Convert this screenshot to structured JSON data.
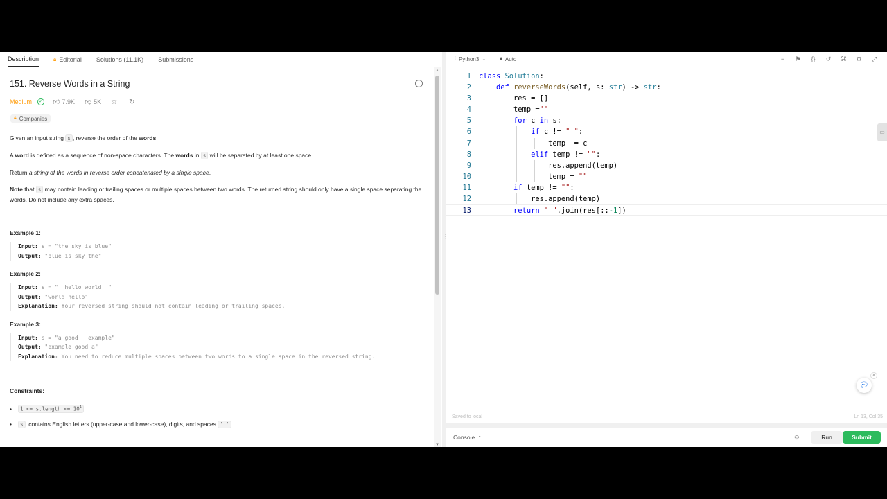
{
  "tabs": [
    {
      "label": "Description"
    },
    {
      "label": "Editorial"
    },
    {
      "label": "Solutions (11.1K)"
    },
    {
      "label": "Submissions"
    }
  ],
  "problem": {
    "title": "151. Reverse Words in a String",
    "difficulty": "Medium",
    "likes": "7.9K",
    "dislikes": "5K",
    "companies_label": "Companies",
    "desc1_a": "Given an input string ",
    "desc1_code": "s",
    "desc1_b": ", reverse the order of the ",
    "desc1_bold": "words",
    "desc1_c": ".",
    "desc2_a": "A ",
    "desc2_bold1": "word",
    "desc2_b": " is defined as a sequence of non-space characters. The ",
    "desc2_bold2": "words",
    "desc2_c": " in ",
    "desc2_code": "s",
    "desc2_d": " will be separated by at least one space.",
    "desc3_a": "Return ",
    "desc3_em": "a string of the words in reverse order concatenated by a single space",
    "desc3_b": ".",
    "note_bold": "Note",
    "note_a": " that ",
    "note_code": "s",
    "note_b": " may contain leading or trailing spaces or multiple spaces between two words. The returned string should only have a single space separating the words. Do not include any extra spaces."
  },
  "examples": [
    {
      "title": "Example 1:",
      "input": "s = \"the sky is blue\"",
      "output": "\"blue is sky the\""
    },
    {
      "title": "Example 2:",
      "input": "s = \"  hello world  \"",
      "output": "\"world hello\"",
      "explanation": "Your reversed string should not contain leading or trailing spaces."
    },
    {
      "title": "Example 3:",
      "input": "s = \"a good   example\"",
      "output": "\"example good a\"",
      "explanation": "You need to reduce multiple spaces between two words to a single space in the reversed string."
    }
  ],
  "labels": {
    "input": "Input:",
    "output": "Output:",
    "explanation": "Explanation:"
  },
  "constraints": {
    "title": "Constraints:",
    "c1_code": "1 <= s.length <= 10",
    "c1_sup": "4",
    "c2_code": "s",
    "c2_text": " contains English letters (upper-case and lower-case), digits, and spaces ",
    "c2_code2": "' '",
    "c2_end": "."
  },
  "editor": {
    "language": "Python3",
    "mode": "Auto",
    "saved": "Saved to local",
    "cursor": "Ln 13, Col 35",
    "line_numbers": [
      "1",
      "2",
      "3",
      "4",
      "5",
      "6",
      "7",
      "8",
      "9",
      "10",
      "11",
      "12",
      "13"
    ]
  },
  "code": {
    "l1_kw": "class",
    "l1_cls": "Solution",
    "l1_end": ":",
    "l2_kw": "def",
    "l2_fn": "reverseWords",
    "l2_a": "(self, s: ",
    "l2_t1": "str",
    "l2_b": ") -> ",
    "l2_t2": "str",
    "l2_c": ":",
    "l3": "res = []",
    "l4_a": "temp =",
    "l4_s": "\"\"",
    "l5_kw1": "for",
    "l5_a": " c ",
    "l5_kw2": "in",
    "l5_b": " s:",
    "l6_kw": "if",
    "l6_a": " c != ",
    "l6_s": "\" \"",
    "l6_b": ":",
    "l7": "temp += c",
    "l8_kw": "elif",
    "l8_a": " temp != ",
    "l8_s": "\"\"",
    "l8_b": ":",
    "l9": "res.append(temp)",
    "l10_a": "temp = ",
    "l10_s": "\"\"",
    "l11_kw": "if",
    "l11_a": " temp != ",
    "l11_s": "\"\"",
    "l11_b": ":",
    "l12": "res.append(temp)",
    "l13_kw": "return",
    "l13_s": "\" \"",
    "l13_a": ".join(res[::",
    "l13_n": "-1",
    "l13_b": "])"
  },
  "console": {
    "label": "Console",
    "run": "Run",
    "submit": "Submit"
  }
}
